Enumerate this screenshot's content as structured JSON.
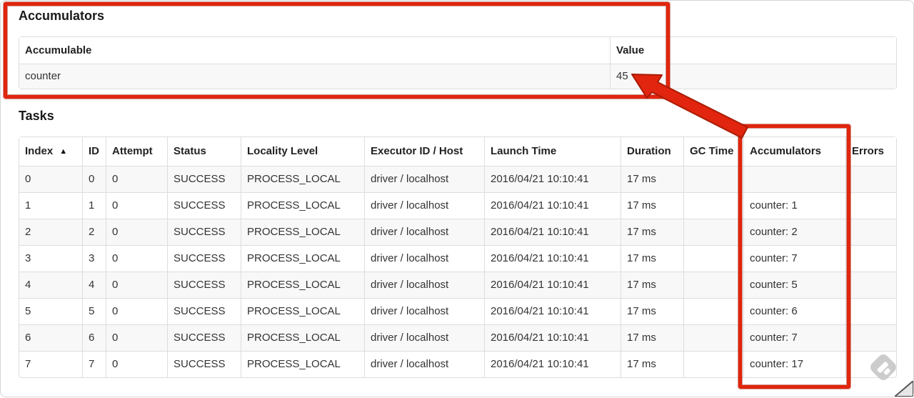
{
  "accumulators_section": {
    "heading": "Accumulators",
    "table": {
      "headers": [
        "Accumulable",
        "Value"
      ],
      "rows": [
        [
          "counter",
          "45"
        ]
      ]
    }
  },
  "tasks_section": {
    "heading": "Tasks",
    "table": {
      "headers": [
        "Index",
        "ID",
        "Attempt",
        "Status",
        "Locality Level",
        "Executor ID / Host",
        "Launch Time",
        "Duration",
        "GC Time",
        "Accumulators",
        "Errors"
      ],
      "sorted_column": "Index",
      "sort_direction_icon": "▲",
      "rows": [
        [
          "0",
          "0",
          "0",
          "SUCCESS",
          "PROCESS_LOCAL",
          "driver / localhost",
          "2016/04/21 10:10:41",
          "17 ms",
          "",
          "",
          ""
        ],
        [
          "1",
          "1",
          "0",
          "SUCCESS",
          "PROCESS_LOCAL",
          "driver / localhost",
          "2016/04/21 10:10:41",
          "17 ms",
          "",
          "counter: 1",
          ""
        ],
        [
          "2",
          "2",
          "0",
          "SUCCESS",
          "PROCESS_LOCAL",
          "driver / localhost",
          "2016/04/21 10:10:41",
          "17 ms",
          "",
          "counter: 2",
          ""
        ],
        [
          "3",
          "3",
          "0",
          "SUCCESS",
          "PROCESS_LOCAL",
          "driver / localhost",
          "2016/04/21 10:10:41",
          "17 ms",
          "",
          "counter: 7",
          ""
        ],
        [
          "4",
          "4",
          "0",
          "SUCCESS",
          "PROCESS_LOCAL",
          "driver / localhost",
          "2016/04/21 10:10:41",
          "17 ms",
          "",
          "counter: 5",
          ""
        ],
        [
          "5",
          "5",
          "0",
          "SUCCESS",
          "PROCESS_LOCAL",
          "driver / localhost",
          "2016/04/21 10:10:41",
          "17 ms",
          "",
          "counter: 6",
          ""
        ],
        [
          "6",
          "6",
          "0",
          "SUCCESS",
          "PROCESS_LOCAL",
          "driver / localhost",
          "2016/04/21 10:10:41",
          "17 ms",
          "",
          "counter: 7",
          ""
        ],
        [
          "7",
          "7",
          "0",
          "SUCCESS",
          "PROCESS_LOCAL",
          "driver / localhost",
          "2016/04/21 10:10:41",
          "17 ms",
          "",
          "counter: 17",
          ""
        ]
      ]
    }
  },
  "annotations": {
    "highlight_color": "#e1250e",
    "arrow_outline_color": "#a81c05",
    "boxes": [
      "accumulators-section-highlight",
      "accumulators-column-highlight"
    ],
    "arrow_target_value": "45"
  },
  "watermark": {
    "icon": "annotation-app-logo-icon",
    "color": "#cccccc"
  }
}
